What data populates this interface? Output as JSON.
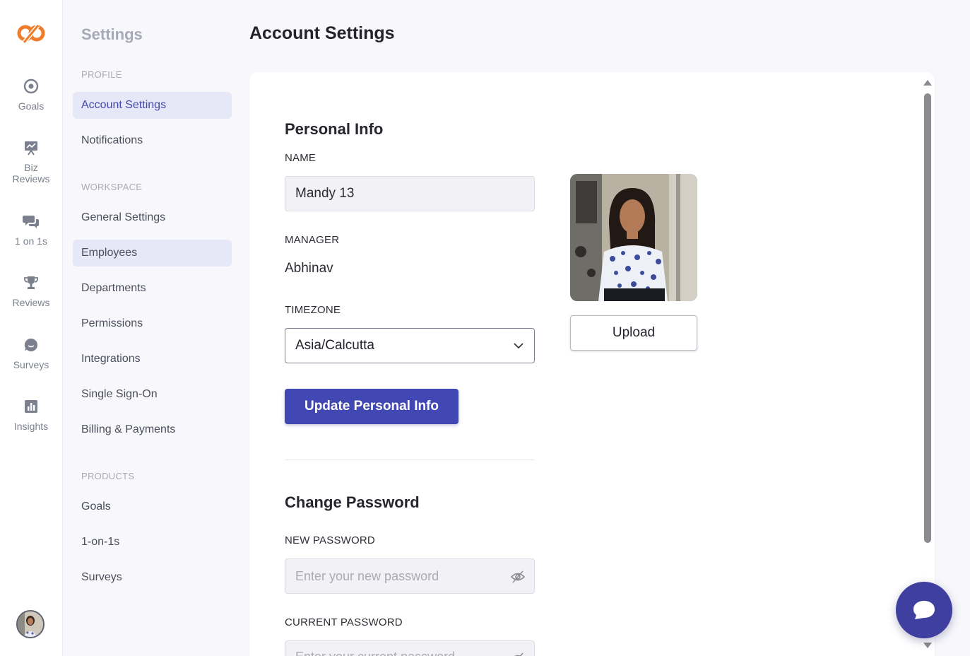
{
  "rail": {
    "items": [
      {
        "label": "Goals",
        "icon": "target-icon"
      },
      {
        "label": "Biz\nReviews",
        "icon": "presentation-chart-icon"
      },
      {
        "label": "1 on 1s",
        "icon": "chat-bubbles-icon"
      },
      {
        "label": "Reviews",
        "icon": "trophy-icon"
      },
      {
        "label": "Surveys",
        "icon": "speech-bubble-icon"
      },
      {
        "label": "Insights",
        "icon": "bar-chart-icon"
      }
    ]
  },
  "settings_nav": {
    "title": "Settings",
    "sections": {
      "profile": "PROFILE",
      "workspace": "WORKSPACE",
      "products": "PRODUCTS"
    },
    "profile_items": [
      "Account Settings",
      "Notifications"
    ],
    "workspace_items": [
      "General Settings",
      "Employees",
      "Departments",
      "Permissions",
      "Integrations",
      "Single Sign-On",
      "Billing & Payments"
    ],
    "product_items": [
      "Goals",
      "1-on-1s",
      "Surveys"
    ],
    "active": "Account Settings",
    "hovered": "Employees"
  },
  "page": {
    "title": "Account Settings"
  },
  "personal_info": {
    "heading": "Personal Info",
    "name_label": "NAME",
    "name_value": "Mandy 13",
    "manager_label": "MANAGER",
    "manager_value": "Abhinav",
    "timezone_label": "TIMEZONE",
    "timezone_value": "Asia/Calcutta",
    "update_button": "Update Personal Info",
    "upload_button": "Upload"
  },
  "change_password": {
    "heading": "Change Password",
    "new_label": "NEW PASSWORD",
    "new_placeholder": "Enter your new password",
    "current_label": "CURRENT PASSWORD",
    "current_placeholder": "Enter your current password"
  },
  "colors": {
    "accent": "#4148b4",
    "logo": "#f07c2a",
    "chat": "#3e3f9e"
  }
}
